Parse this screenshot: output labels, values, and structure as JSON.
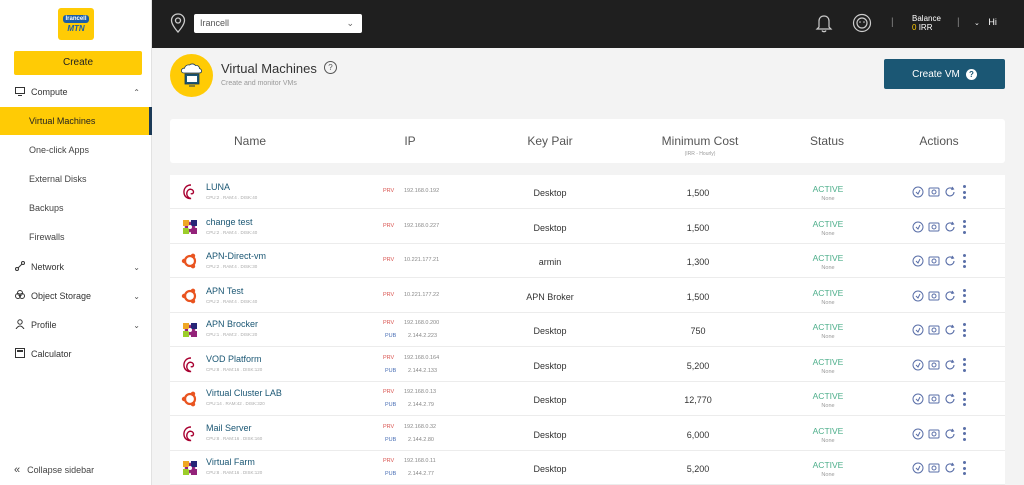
{
  "brand": {
    "logo_top": "Irancell",
    "logo_bottom": "MTN",
    "accent": "#ffcb05",
    "primary": "#1b5774"
  },
  "sidebar": {
    "create_label": "Create",
    "compute_label": "Compute",
    "compute_items": [
      "Virtual Machines",
      "One-click Apps",
      "External Disks",
      "Backups",
      "Firewalls"
    ],
    "network_label": "Network",
    "object_storage_label": "Object Storage",
    "profile_label": "Profile",
    "calculator_label": "Calculator",
    "collapse_label": "Collapse sidebar"
  },
  "topbar": {
    "region": "Irancell",
    "balance_label": "Balance",
    "balance_amount": "0",
    "balance_currency": "IRR",
    "user_greeting": "Hi"
  },
  "page": {
    "title": "Virtual Machines",
    "subtitle": "Create and monitor VMs",
    "create_vm_label": "Create VM"
  },
  "table": {
    "headers": {
      "name": "Name",
      "ip": "IP",
      "keypair": "Key Pair",
      "cost": "Minimum Cost",
      "cost_sub": "(IRR - Hourly)",
      "status": "Status",
      "actions": "Actions"
    },
    "prv_label": "PRV",
    "pub_label": "PUB",
    "rows": [
      {
        "os": "debian-icon",
        "name": "LUNA",
        "spec": "CPU:2 . RAM:4 . DISK:40",
        "prv": "192.168.0.192",
        "pub": "",
        "keypair": "Desktop",
        "cost": "1,500",
        "status": "ACTIVE",
        "status_sub": "None"
      },
      {
        "os": "centos-icon",
        "name": "change test",
        "spec": "CPU:2 . RAM:4 . DISK:40",
        "prv": "192.168.0.227",
        "pub": "",
        "keypair": "Desktop",
        "cost": "1,500",
        "status": "ACTIVE",
        "status_sub": "None"
      },
      {
        "os": "ubuntu-icon",
        "name": "APN-Direct-vm",
        "spec": "CPU:2 . RAM:4 . DISK:30",
        "prv": "10.221.177.21",
        "pub": "",
        "keypair": "armin",
        "cost": "1,300",
        "status": "ACTIVE",
        "status_sub": "None"
      },
      {
        "os": "ubuntu-icon",
        "name": "APN Test",
        "spec": "CPU:2 . RAM:4 . DISK:40",
        "prv": "10.221.177.22",
        "pub": "",
        "keypair": "APN Broker",
        "cost": "1,500",
        "status": "ACTIVE",
        "status_sub": "None"
      },
      {
        "os": "centos-icon",
        "name": "APN Brocker",
        "spec": "CPU:1 . RAM:2 . DISK:20",
        "prv": "192.168.0.200",
        "pub": "2.144.2.223",
        "keypair": "Desktop",
        "cost": "750",
        "status": "ACTIVE",
        "status_sub": "None"
      },
      {
        "os": "debian-icon",
        "name": "VOD Platform",
        "spec": "CPU:8 . RAM:16 . DISK:120",
        "prv": "192.168.0.164",
        "pub": "2.144.2.133",
        "keypair": "Desktop",
        "cost": "5,200",
        "status": "ACTIVE",
        "status_sub": "None"
      },
      {
        "os": "ubuntu-icon",
        "name": "Virtual Cluster LAB",
        "spec": "CPU:14 . RAM:42 . DISK:320",
        "prv": "192.168.0.13",
        "pub": "2.144.2.79",
        "keypair": "Desktop",
        "cost": "12,770",
        "status": "ACTIVE",
        "status_sub": "None"
      },
      {
        "os": "debian-icon",
        "name": "Mail Server",
        "spec": "CPU:8 . RAM:16 . DISK:160",
        "prv": "192.168.0.32",
        "pub": "2.144.2.80",
        "keypair": "Desktop",
        "cost": "6,000",
        "status": "ACTIVE",
        "status_sub": "None"
      },
      {
        "os": "centos-icon",
        "name": "Virtual Farm",
        "spec": "CPU:8 . RAM:16 . DISK:120",
        "prv": "192.168.0.11",
        "pub": "2.144.2.77",
        "keypair": "Desktop",
        "cost": "5,200",
        "status": "ACTIVE",
        "status_sub": "None"
      }
    ]
  }
}
